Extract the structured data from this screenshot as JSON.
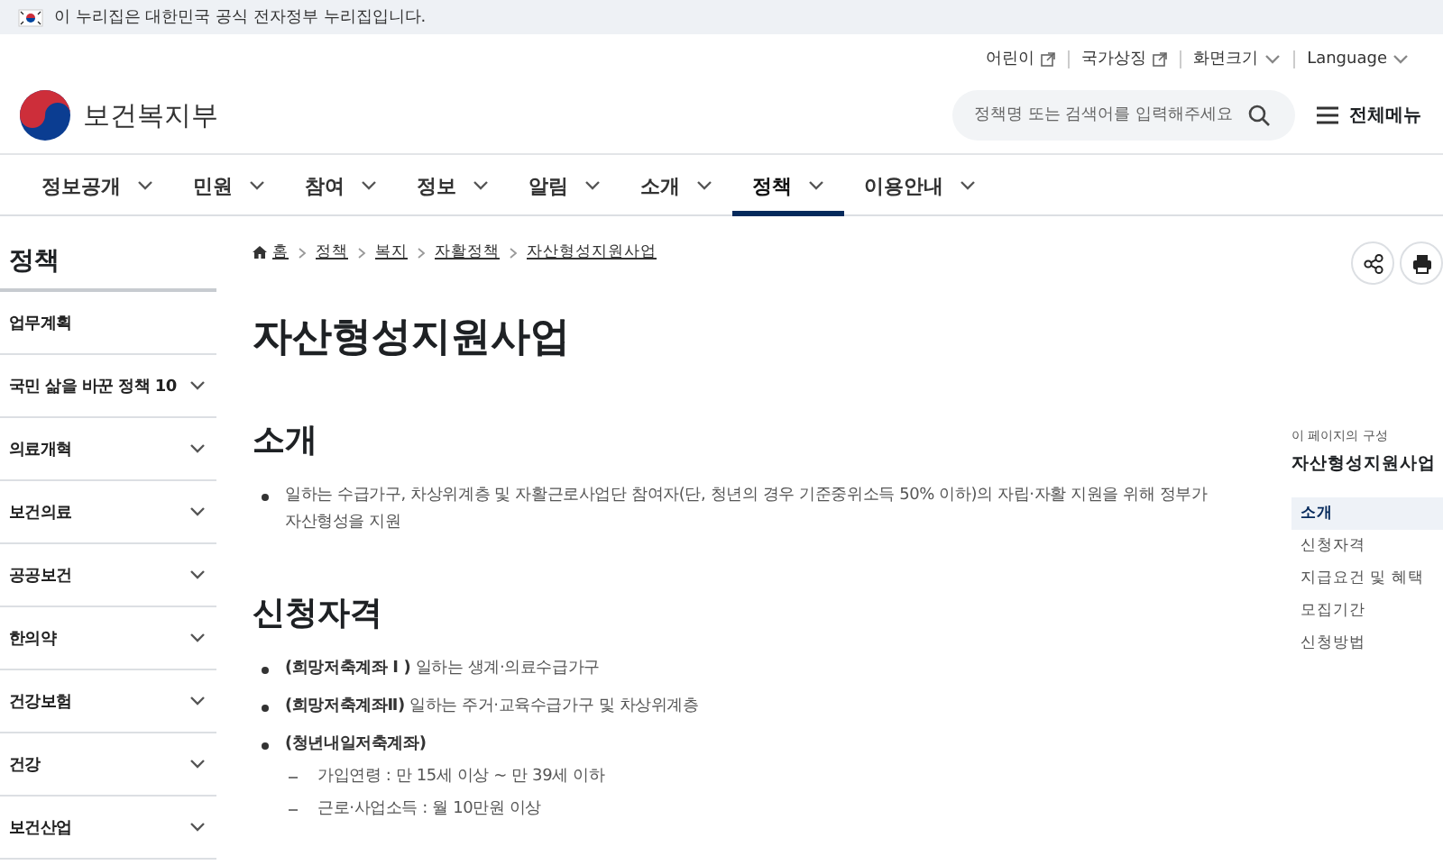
{
  "banner": {
    "text": "이 누리집은 대한민국 공식 전자정부 누리집입니다."
  },
  "utility_links": [
    {
      "label": "어린이",
      "kind": "external"
    },
    {
      "label": "국가상징",
      "kind": "external"
    },
    {
      "label": "화면크기",
      "kind": "dropdown"
    },
    {
      "label": "Language",
      "kind": "dropdown"
    }
  ],
  "logo": {
    "text": "보건복지부"
  },
  "search": {
    "placeholder": "정책명 또는 검색어를 입력해주세요"
  },
  "menu_button": {
    "label": "전체메뉴"
  },
  "nav": [
    {
      "label": "정보공개",
      "selected": false
    },
    {
      "label": "민원",
      "selected": false
    },
    {
      "label": "참여",
      "selected": false
    },
    {
      "label": "정보",
      "selected": false
    },
    {
      "label": "알림",
      "selected": false
    },
    {
      "label": "소개",
      "selected": false
    },
    {
      "label": "정책",
      "selected": true
    },
    {
      "label": "이용안내",
      "selected": false
    }
  ],
  "sidebar": {
    "title": "정책",
    "items": [
      {
        "label": "업무계획",
        "expandable": false
      },
      {
        "label": "국민 삶을 바꾼 정책 10",
        "expandable": true
      },
      {
        "label": "의료개혁",
        "expandable": true
      },
      {
        "label": "보건의료",
        "expandable": true
      },
      {
        "label": "공공보건",
        "expandable": true
      },
      {
        "label": "한의약",
        "expandable": true
      },
      {
        "label": "건강보험",
        "expandable": true
      },
      {
        "label": "건강",
        "expandable": true
      },
      {
        "label": "보건산업",
        "expandable": true
      }
    ]
  },
  "breadcrumb": [
    "홈",
    "정책",
    "복지",
    "자활정책",
    "자산형성지원사업"
  ],
  "page_title": "자산형성지원사업",
  "sections": [
    {
      "heading": "소개",
      "items": [
        {
          "text": "일하는 수급가구, 차상위계층 및 자활근로사업단 참여자(단, 청년의 경우 기준중위소득 50% 이하)의 자립·자활 지원을 위해 정부가 자산형성을 지원"
        }
      ]
    },
    {
      "heading": "신청자격",
      "items": [
        {
          "text": "**(희망저축계좌 Ⅰ )** 일하는 생계·의료수급가구"
        },
        {
          "text": "**(희망저축계좌Ⅱ)** 일하는 주거·교육수급가구 및 차상위계층"
        },
        {
          "text": "**(청년내일저축계좌)**",
          "children": [
            {
              "text": "가입연령 : 만 15세 이상 ~ 만 39세 이하"
            },
            {
              "text": "근로·사업소득 : 월 10만원 이상"
            }
          ]
        }
      ]
    }
  ],
  "toc": {
    "caption": "이 페이지의 구성",
    "title": "자산형성지원사업",
    "items": [
      {
        "label": "소개",
        "selected": true
      },
      {
        "label": "신청자격",
        "selected": false
      },
      {
        "label": "지급요건 및 혜택",
        "selected": false
      },
      {
        "label": "모집기간",
        "selected": false
      },
      {
        "label": "신청방법",
        "selected": false
      }
    ]
  }
}
